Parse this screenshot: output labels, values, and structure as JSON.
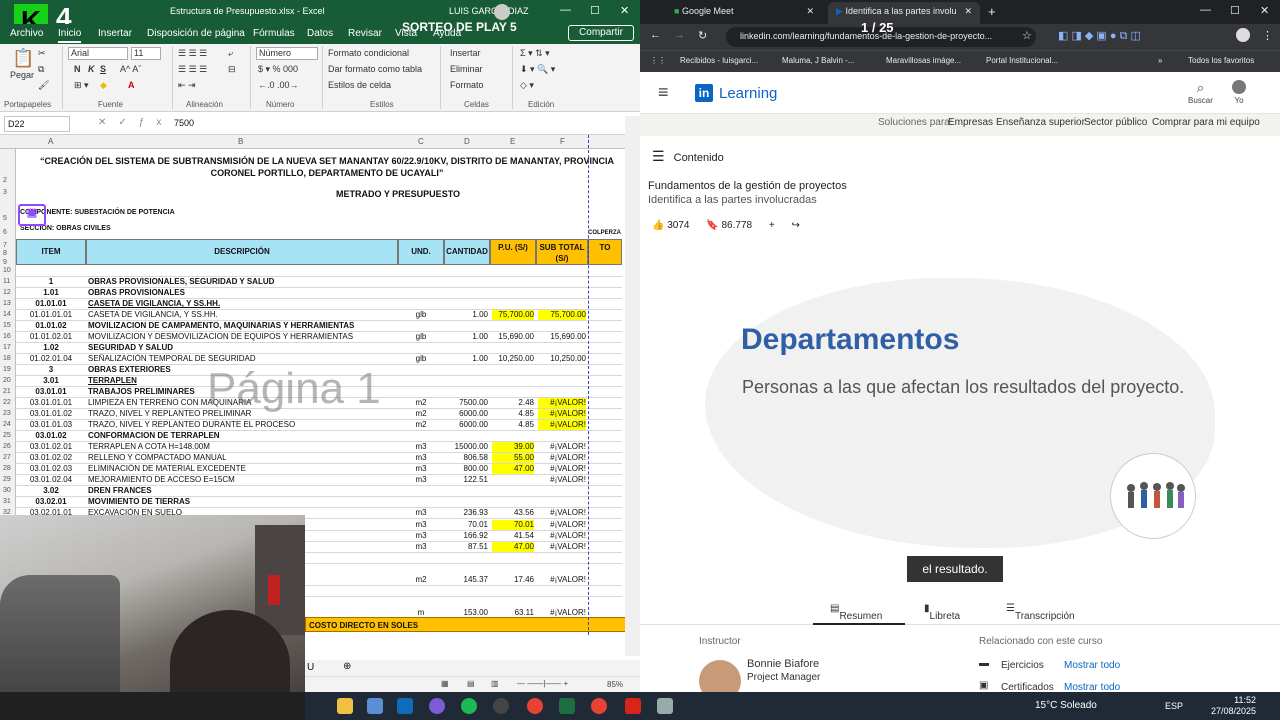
{
  "excel": {
    "title": "Estructura de Presupuesto.xlsx - Excel",
    "user": "LUIS GARCIA DIAZ",
    "logo": "K",
    "logo_num": "4",
    "overlay_banner": "SORTEO DE PLAY 5",
    "menu": [
      "Archivo",
      "Inicio",
      "Insertar",
      "Disposición de página",
      "Fórmulas",
      "Datos",
      "Revisar",
      "Vista",
      "Ayuda"
    ],
    "share_label": "Compartir",
    "ribbon": {
      "paste_label": "Pegar",
      "font_name": "Arial",
      "font_size": "11",
      "number_format": "Número",
      "cond_format": "Formato condicional",
      "table_format": "Dar formato como tabla",
      "cell_styles": "Estilos de celda",
      "insert": "Insertar",
      "delete": "Eliminar",
      "format": "Formato",
      "groups": [
        "Portapapeles",
        "Fuente",
        "Alineación",
        "Número",
        "Estilos",
        "Celdas",
        "Edición"
      ]
    },
    "name_box": "D22",
    "formula_value": "7500",
    "columns": [
      "A",
      "B",
      "C",
      "D",
      "E",
      "F"
    ],
    "header_title_1": "“CREACIÓN DEL SISTEMA DE SUBTRANSMISIÓN DE LA NUEVA SET MANANTAY 60/22.9/10KV, DISTRITO DE MANANTAY, PROVINCIA",
    "header_title_2": "CORONEL PORTILLO, DEPARTAMENTO DE UCAYALI”",
    "header_title_3": "METRADO Y PRESUPUESTO",
    "component_line": "COMPONENTE: SUBESTACIÓN DE POTENCIA",
    "section_line": "SECCIÓN: OBRAS CIVILES",
    "colperza": "COLPERZA",
    "table_headers": {
      "item": "ITEM",
      "desc": "DESCRIPCIÓN",
      "und": "UND.",
      "cant": "CANTIDAD",
      "pu": "P.U. (S/)",
      "sub": "SUB TOTAL (S/)",
      "tot": "TO"
    },
    "rows": [
      {
        "n": "10",
        "item": "",
        "desc": "",
        "und": "",
        "cant": "",
        "pu": "",
        "sub": "",
        "bold": false
      },
      {
        "n": "11",
        "item": "1",
        "desc": "OBRAS PROVISIONALES, SEGURIDAD Y SALUD",
        "und": "",
        "cant": "",
        "pu": "",
        "sub": "",
        "bold": true
      },
      {
        "n": "12",
        "item": "1.01",
        "desc": "OBRAS PROVISIONALES",
        "und": "",
        "cant": "",
        "pu": "",
        "sub": "",
        "bold": true
      },
      {
        "n": "13",
        "item": "01.01.01",
        "desc": "CASETA DE VIGILANCIA, Y SS.HH.",
        "und": "",
        "cant": "",
        "pu": "",
        "sub": "",
        "bold": true
      },
      {
        "n": "14",
        "item": "01.01.01.01",
        "desc": "CASETA DE VIGILANCIA, Y SS.HH.",
        "und": "glb",
        "cant": "1.00",
        "pu": "75,700.00",
        "sub": "75,700.00",
        "bold": false,
        "ypu": true,
        "ysub": true
      },
      {
        "n": "15",
        "item": "01.01.02",
        "desc": "MOVILIZACION DE CAMPAMENTO, MAQUINARIAS Y HERRAMIENTAS",
        "und": "",
        "cant": "",
        "pu": "",
        "sub": "",
        "bold": true
      },
      {
        "n": "16",
        "item": "01.01.02.01",
        "desc": "MOVILIZACION Y DESMOVILIZACION DE EQUIPOS Y HERRAMIENTAS",
        "und": "glb",
        "cant": "1.00",
        "pu": "15,690.00",
        "sub": "15,690.00",
        "bold": false
      },
      {
        "n": "17",
        "item": "1.02",
        "desc": "SEGURIDAD Y SALUD",
        "und": "",
        "cant": "",
        "pu": "",
        "sub": "",
        "bold": true
      },
      {
        "n": "18",
        "item": "01.02.01.04",
        "desc": "SEÑALIZACIÓN TEMPORAL DE SEGURIDAD",
        "und": "glb",
        "cant": "1.00",
        "pu": "10,250.00",
        "sub": "10,250.00",
        "bold": false
      },
      {
        "n": "19",
        "item": "3",
        "desc": "OBRAS EXTERIORES",
        "und": "",
        "cant": "",
        "pu": "",
        "sub": "",
        "bold": true
      },
      {
        "n": "20",
        "item": "3.01",
        "desc": "TERRAPLEN",
        "und": "",
        "cant": "",
        "pu": "",
        "sub": "",
        "bold": true
      },
      {
        "n": "21",
        "item": "03.01.01",
        "desc": "TRABAJOS PRELIMINARES",
        "und": "",
        "cant": "",
        "pu": "",
        "sub": "",
        "bold": true
      },
      {
        "n": "22",
        "item": "03.01.01.01",
        "desc": "LIMPIEZA EN TERRENO CON MAQUINARIA",
        "und": "m2",
        "cant": "7500.00",
        "pu": "2.48",
        "sub": "#¡VALOR!",
        "bold": false,
        "ysub": true
      },
      {
        "n": "23",
        "item": "03.01.01.02",
        "desc": "TRAZO, NIVEL Y REPLANTEO PRELIMINAR",
        "und": "m2",
        "cant": "6000.00",
        "pu": "4.85",
        "sub": "#¡VALOR!",
        "bold": false,
        "ysub": true
      },
      {
        "n": "24",
        "item": "03.01.01.03",
        "desc": "TRAZO, NIVEL Y REPLANTEO DURANTE EL PROCESO",
        "und": "m2",
        "cant": "6000.00",
        "pu": "4.85",
        "sub": "#¡VALOR!",
        "bold": false,
        "ysub": true
      },
      {
        "n": "25",
        "item": "03.01.02",
        "desc": "CONFORMACION DE TERRAPLEN",
        "und": "",
        "cant": "",
        "pu": "",
        "sub": "",
        "bold": true
      },
      {
        "n": "26",
        "item": "03.01.02.01",
        "desc": "TERRAPLEN A COTA H=148.00M",
        "und": "m3",
        "cant": "15000.00",
        "pu": "39.00",
        "sub": "#¡VALOR!",
        "bold": false,
        "ypu": true
      },
      {
        "n": "27",
        "item": "03.01.02.02",
        "desc": "RELLENO Y COMPACTADO MANUAL",
        "und": "m3",
        "cant": "806.58",
        "pu": "55.00",
        "sub": "#¡VALOR!",
        "bold": false,
        "ypu": true
      },
      {
        "n": "28",
        "item": "03.01.02.03",
        "desc": "ELIMINACIÓN DE MATERIAL EXCEDENTE",
        "und": "m3",
        "cant": "800.00",
        "pu": "47.00",
        "sub": "#¡VALOR!",
        "bold": false,
        "ypu": true
      },
      {
        "n": "29",
        "item": "03.01.02.04",
        "desc": "MEJORAMIENTO DE ACCESO E=15CM",
        "und": "m3",
        "cant": "122.51",
        "pu": "",
        "sub": "#¡VALOR!",
        "bold": false,
        "ypu": true
      },
      {
        "n": "30",
        "item": "3.02",
        "desc": "DREN FRANCES",
        "und": "",
        "cant": "",
        "pu": "",
        "sub": "",
        "bold": true
      },
      {
        "n": "31",
        "item": "03.02.01",
        "desc": "MOVIMIENTO DE TIERRAS",
        "und": "",
        "cant": "",
        "pu": "",
        "sub": "",
        "bold": true
      },
      {
        "n": "32",
        "item": "03.02.01.01",
        "desc": "EXCAVACIÓN EN SUELO",
        "und": "m3",
        "cant": "236.93",
        "pu": "43.56",
        "sub": "#¡VALOR!",
        "bold": false
      }
    ],
    "lower_rows": [
      {
        "und": "m3",
        "cant": "70.01",
        "pu": "70.01",
        "sub": "#¡VALOR!",
        "ypu": true
      },
      {
        "und": "m3",
        "cant": "166.92",
        "pu": "41.54",
        "sub": "#¡VALOR!"
      },
      {
        "und": "m3",
        "cant": "87.51",
        "pu": "47.00",
        "sub": "#¡VALOR!",
        "ypu": true
      },
      {
        "und": "",
        "cant": "",
        "pu": "",
        "sub": ""
      },
      {
        "und": "m2",
        "cant": "145.37",
        "pu": "17.46",
        "sub": "#¡VALOR!"
      },
      {
        "und": "",
        "cant": "",
        "pu": "",
        "sub": ""
      },
      {
        "und": "m",
        "cant": "153.00",
        "pu": "63.11",
        "sub": "#¡VALOR!"
      },
      {
        "und": "m",
        "cant": "156.70",
        "pu": "63.11",
        "sub": "#¡VALOR!"
      }
    ],
    "page_watermark": "Página 1",
    "costo_directo": "COSTO DIRECTO EN SOLES",
    "zoom": "85%"
  },
  "chrome": {
    "tabs": [
      {
        "label": "Google Meet",
        "active": false
      },
      {
        "label": "Identifica a las partes involu",
        "active": true
      }
    ],
    "page_counter": "1 / 25",
    "url": "linkedin.com/learning/fundamentos-de-la-gestion-de-proyecto...",
    "bookmarks": [
      "Recibidos - luisgarci...",
      "Maluma, J Balvin -...",
      "Maravillosas imáge...",
      "Portal Institucional...",
      "Todos los favoritos"
    ],
    "learning_label": "Learning",
    "li_logo": "in",
    "buscar": "Buscar",
    "yo": "Yo",
    "soluciones_label": "Soluciones para:",
    "soluciones": [
      "Empresas",
      "Enseñanza superior",
      "Sector público",
      "Comprar para mi equipo"
    ],
    "contenido": "Contenido",
    "course_title": "Fundamentos de la gestión de proyectos",
    "lesson_title": "Identifica a las partes involucradas",
    "likes": "3074",
    "saves": "86.778",
    "slide_title": "Departamentos",
    "slide_subtitle": "Personas a las que afectan los resultados del proyecto.",
    "caption": "el resultado.",
    "video_tabs": [
      "Resumen",
      "Libreta",
      "Transcripción"
    ],
    "instructor_label": "Instructor",
    "instructor_name": "Bonnie Biafore",
    "instructor_role": "Project Manager",
    "related_label": "Relacionado con este curso",
    "related": [
      {
        "name": "Ejercicios",
        "link": "Mostrar todo"
      },
      {
        "name": "Certificados",
        "link": "Mostrar todo"
      }
    ]
  },
  "taskbar": {
    "weather": "15°C  Soleado",
    "lang": "ESP",
    "time": "11:52",
    "date": "27/08/2025"
  }
}
